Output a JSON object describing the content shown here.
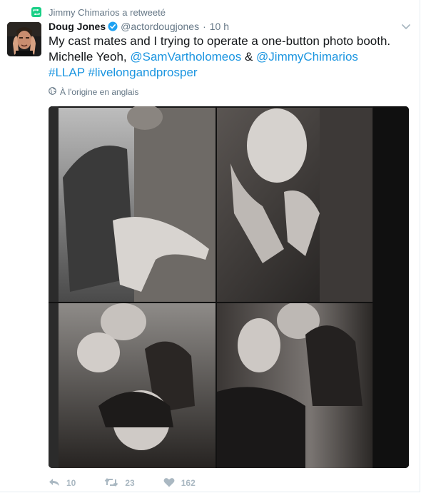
{
  "retweet_context": {
    "text": "Jimmy Chimarios a retweeté"
  },
  "author": {
    "fullname": "Doug Jones",
    "handle": "@actordougjones",
    "separator": "·",
    "time": "10 h"
  },
  "tweet": {
    "line1": "My cast mates and I trying to operate a one-button photo booth.",
    "line2_prefix": "Michelle Yeoh,",
    "mention1": "@SamVartholomeos",
    "line2_mid": "&",
    "mention2": "@JimmyChimarios",
    "hashtag1": "#LLAP",
    "hashtag2": "#livelongandprosper"
  },
  "translate": {
    "label": "À l'origine en anglais"
  },
  "actions": {
    "reply_count": "10",
    "retweet_count": "23",
    "like_count": "162"
  },
  "colors": {
    "link": "#1b95e0",
    "verified": "#1da1f2",
    "retweet_badge": "#19cf86",
    "secondary_text": "#657786",
    "action_icons": "#aab8c2"
  }
}
